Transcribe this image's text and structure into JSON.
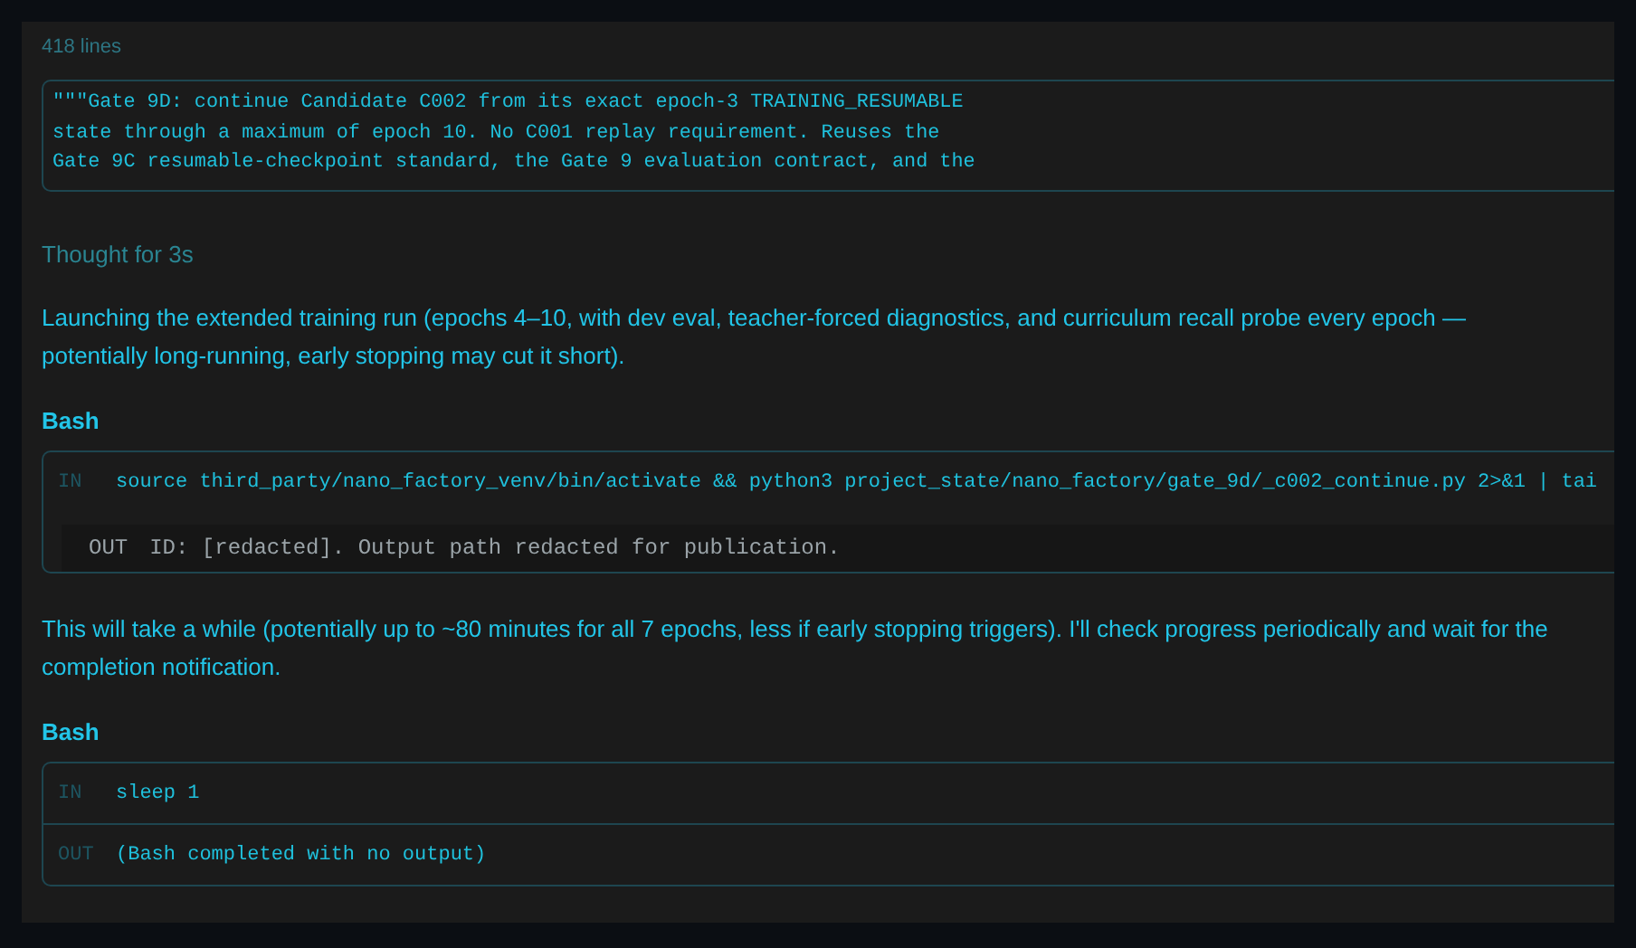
{
  "file_preview": {
    "line_count": "418 lines",
    "code_lines": [
      "\"\"\"Gate 9D: continue Candidate C002 from its exact epoch-3 TRAINING_RESUMABLE",
      "state through a maximum of epoch 10. No C001 replay requirement. Reuses the",
      "Gate 9C resumable-checkpoint standard, the Gate 9 evaluation contract, and the"
    ]
  },
  "thought": "Thought for 3s",
  "messages": [
    {
      "kind": "text",
      "text": "Launching the extended training run (epochs 4–10, with dev eval, teacher-forced diagnostics, and curriculum recall probe every epoch — potentially long-running, early stopping may cut it short)."
    },
    {
      "kind": "tool",
      "title": "Bash",
      "rows": [
        {
          "label": "IN",
          "text": "source third_party/nano_factory_venv/bin/activate && python3 project_state/nano_factory/gate_9d/_c002_continue.py 2>&1 | tai"
        }
      ],
      "overlay": {
        "label": "OUT",
        "text": "ID: [redacted]. Output path redacted for publication."
      }
    },
    {
      "kind": "text",
      "text": "This will take a while (potentially up to ~80 minutes for all 7 epochs, less if early stopping triggers). I'll check progress periodically and wait for the completion notification."
    },
    {
      "kind": "tool",
      "title": "Bash",
      "rows": [
        {
          "label": "IN",
          "text": "sleep 1"
        },
        {
          "label": "OUT",
          "text": "(Bash completed with no output)"
        }
      ]
    }
  ]
}
